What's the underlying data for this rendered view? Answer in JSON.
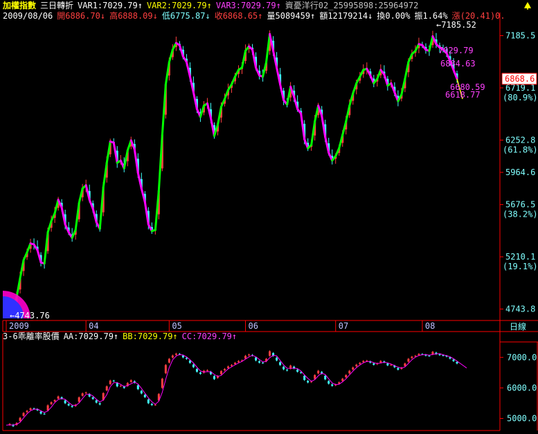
{
  "header": {
    "title": "加權指數",
    "mode": "三日轉折",
    "var1": "VAR1:7029.79↑",
    "var2": "VAR2:7029.79↑",
    "var3": "VAR3:7029.79↑",
    "code": "資憂洋行02_25995898:25964972",
    "date": "2009/08/06",
    "open": "開6886.70↓",
    "high": "高6888.09↓",
    "low": "低6775.87↓",
    "close": "收6868.65↑",
    "volume": "量5089459↑",
    "amount": "額12179214↓",
    "turnover": "換0.00%",
    "amplitude": "振1.64%",
    "change": "漲(20.41)0."
  },
  "sub_header": {
    "title": "3-6乖離率股價",
    "aa": "AA:7029.79↑",
    "bb": "BB:7029.79↑",
    "cc": "CC:7029.79↑"
  },
  "annotations": {
    "high_label": "7185.52",
    "low_label": "4743.76",
    "v1": "7029.79",
    "v2": "6884.63",
    "v3": "6680.59",
    "v4": "6618.77"
  },
  "period_label": "日線",
  "colors": {
    "up_line": "#00ff00",
    "down_line": "#ff00ff",
    "candle_up": "#ff4040",
    "candle_down": "#40ffff",
    "axis": "#ff0000",
    "text_white": "#ffffff",
    "text_yellow": "#ffff00",
    "text_magenta": "#ff40ff",
    "text_cyan": "#80ffff",
    "price_box": "#ff0000"
  },
  "chart_data": [
    {
      "type": "line",
      "title": "加權指數 三日轉折",
      "x_ticks": [
        "2009",
        "04",
        "05",
        "06",
        "07",
        "08"
      ],
      "y_ticks": [
        {
          "value": 7185.5,
          "label": "7185.5"
        },
        {
          "value": 6719.1,
          "label": "6719.1",
          "pct": "(80.9%)"
        },
        {
          "value": 6252.8,
          "label": "6252.8",
          "pct": "(61.8%)"
        },
        {
          "value": 5964.6,
          "label": "5964.6"
        },
        {
          "value": 5676.5,
          "label": "5676.5",
          "pct": "(38.2%)"
        },
        {
          "value": 5210.1,
          "label": "5210.1",
          "pct": "(19.1%)"
        },
        {
          "value": 4743.8,
          "label": "4743.8"
        }
      ],
      "ylim": [
        4660,
        7300
      ],
      "last_price": "6868.6",
      "series": [
        {
          "values": [
            4780,
            4820,
            4750,
            4850,
            5020,
            5180,
            5250,
            5330,
            5320,
            5270,
            5160,
            5150,
            5430,
            5530,
            5600,
            5720,
            5650,
            5500,
            5430,
            5380,
            5450,
            5690,
            5820,
            5850,
            5720,
            5640,
            5520,
            5460,
            5830,
            6050,
            6240,
            6230,
            6050,
            6070,
            6000,
            6160,
            6250,
            6170,
            5960,
            5820,
            5700,
            5500,
            5440,
            5450,
            5800,
            6300,
            6750,
            6950,
            7060,
            7120,
            7100,
            7000,
            6950,
            6820,
            6680,
            6530,
            6460,
            6560,
            6580,
            6450,
            6290,
            6390,
            6550,
            6620,
            6700,
            6750,
            6820,
            6880,
            6900,
            7050,
            7090,
            7060,
            6900,
            6830,
            6820,
            6950,
            7200,
            7050,
            6900,
            6750,
            6610,
            6570,
            6730,
            6640,
            6530,
            6490,
            6260,
            6180,
            6210,
            6420,
            6560,
            6470,
            6280,
            6140,
            6070,
            6110,
            6180,
            6300,
            6420,
            6560,
            6670,
            6760,
            6820,
            6880,
            6890,
            6830,
            6760,
            6800,
            6880,
            6840,
            6740,
            6760,
            6680,
            6600,
            6660,
            6800,
            6950,
            7020,
            7050,
            7110,
            7100,
            7060,
            7050,
            7180,
            7110,
            7080,
            7060,
            7030,
            6960,
            6880,
            6800
          ]
        }
      ]
    },
    {
      "type": "line",
      "title": "3-6乖離率股價",
      "y_ticks": [
        {
          "value": 7000,
          "label": "7000.0"
        },
        {
          "value": 6000,
          "label": "6000.0"
        },
        {
          "value": 5000,
          "label": "5000.0"
        }
      ],
      "ylim": [
        4650,
        7550
      ],
      "series": [
        {
          "name": "CC",
          "values": [
            4780,
            4820,
            4750,
            4850,
            5020,
            5180,
            5250,
            5330,
            5320,
            5270,
            5160,
            5150,
            5430,
            5530,
            5600,
            5720,
            5650,
            5500,
            5430,
            5380,
            5450,
            5690,
            5820,
            5850,
            5720,
            5640,
            5520,
            5460,
            5830,
            6050,
            6240,
            6230,
            6050,
            6070,
            6000,
            6160,
            6250,
            6170,
            5960,
            5820,
            5700,
            5500,
            5440,
            5450,
            5800,
            6300,
            6750,
            6950,
            7060,
            7120,
            7100,
            7000,
            6950,
            6820,
            6680,
            6530,
            6460,
            6560,
            6580,
            6450,
            6290,
            6390,
            6550,
            6620,
            6700,
            6750,
            6820,
            6880,
            6900,
            7050,
            7090,
            7060,
            6900,
            6830,
            6820,
            6950,
            7200,
            7050,
            6900,
            6750,
            6610,
            6570,
            6730,
            6640,
            6530,
            6490,
            6260,
            6180,
            6210,
            6420,
            6560,
            6470,
            6280,
            6140,
            6070,
            6110,
            6180,
            6300,
            6420,
            6560,
            6670,
            6760,
            6820,
            6880,
            6890,
            6830,
            6760,
            6800,
            6880,
            6840,
            6740,
            6760,
            6680,
            6600,
            6660,
            6800,
            6950,
            7020,
            7050,
            7110,
            7100,
            7060,
            7050,
            7180,
            7110,
            7080,
            7060,
            7030,
            6960,
            6880,
            6800
          ]
        }
      ]
    }
  ]
}
